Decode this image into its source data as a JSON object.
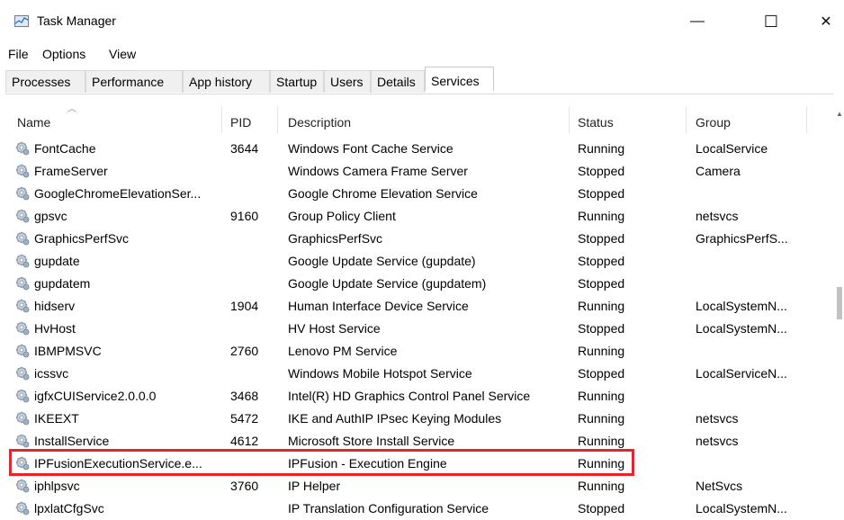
{
  "window": {
    "title": "Task Manager",
    "icon": "task-manager-icon"
  },
  "window_controls": {
    "minimize": "—",
    "maximize": "☐",
    "close": "✕"
  },
  "menu": [
    "File",
    "Options",
    "View"
  ],
  "tabs": [
    "Processes",
    "Performance",
    "App history",
    "Startup",
    "Users",
    "Details",
    "Services"
  ],
  "active_tab": "Services",
  "columns": [
    "Name",
    "PID",
    "Description",
    "Status",
    "Group"
  ],
  "sort": {
    "column": "Name",
    "direction": "ascending"
  },
  "rows": [
    {
      "name": "FontCache",
      "pid": "3644",
      "description": "Windows Font Cache Service",
      "status": "Running",
      "group": "LocalService"
    },
    {
      "name": "FrameServer",
      "pid": "",
      "description": "Windows Camera Frame Server",
      "status": "Stopped",
      "group": "Camera"
    },
    {
      "name": "GoogleChromeElevationSer...",
      "pid": "",
      "description": "Google Chrome Elevation Service",
      "status": "Stopped",
      "group": ""
    },
    {
      "name": "gpsvc",
      "pid": "9160",
      "description": "Group Policy Client",
      "status": "Running",
      "group": "netsvcs"
    },
    {
      "name": "GraphicsPerfSvc",
      "pid": "",
      "description": "GraphicsPerfSvc",
      "status": "Stopped",
      "group": "GraphicsPerfS..."
    },
    {
      "name": "gupdate",
      "pid": "",
      "description": "Google Update Service (gupdate)",
      "status": "Stopped",
      "group": ""
    },
    {
      "name": "gupdatem",
      "pid": "",
      "description": "Google Update Service (gupdatem)",
      "status": "Stopped",
      "group": ""
    },
    {
      "name": "hidserv",
      "pid": "1904",
      "description": "Human Interface Device Service",
      "status": "Running",
      "group": "LocalSystemN..."
    },
    {
      "name": "HvHost",
      "pid": "",
      "description": "HV Host Service",
      "status": "Stopped",
      "group": "LocalSystemN..."
    },
    {
      "name": "IBMPMSVC",
      "pid": "2760",
      "description": "Lenovo PM Service",
      "status": "Running",
      "group": ""
    },
    {
      "name": "icssvc",
      "pid": "",
      "description": "Windows Mobile Hotspot Service",
      "status": "Stopped",
      "group": "LocalServiceN..."
    },
    {
      "name": "igfxCUIService2.0.0.0",
      "pid": "3468",
      "description": "Intel(R) HD Graphics Control Panel Service",
      "status": "Running",
      "group": ""
    },
    {
      "name": "IKEEXT",
      "pid": "5472",
      "description": "IKE and AuthIP IPsec Keying Modules",
      "status": "Running",
      "group": "netsvcs"
    },
    {
      "name": "InstallService",
      "pid": "4612",
      "description": "Microsoft Store Install Service",
      "status": "Running",
      "group": "netsvcs"
    },
    {
      "name": "IPFusionExecutionService.e...",
      "pid": "",
      "description": "IPFusion - Execution Engine",
      "status": "Running",
      "group": "",
      "highlighted": true
    },
    {
      "name": "iphlpsvc",
      "pid": "3760",
      "description": "IP Helper",
      "status": "Running",
      "group": "NetSvcs"
    },
    {
      "name": "lpxlatCfgSvc",
      "pid": "",
      "description": "IP Translation Configuration Service",
      "status": "Stopped",
      "group": "LocalSystemN..."
    }
  ],
  "colors": {
    "highlight_border": "#e8232a",
    "row_icon": "service-gear-icon"
  }
}
